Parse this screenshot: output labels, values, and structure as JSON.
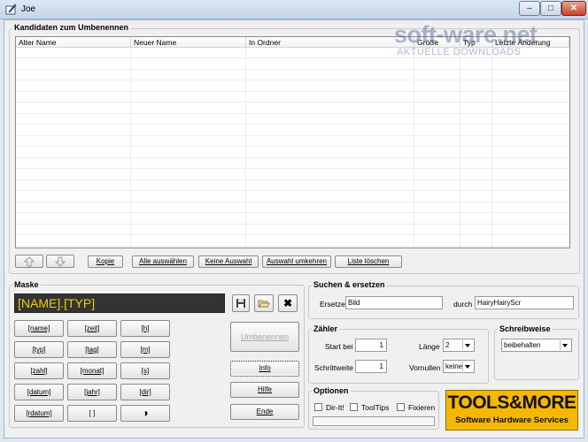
{
  "window": {
    "title": "Joe"
  },
  "candidates": {
    "title": "Kandidaten zum Umbenennen",
    "columns": [
      "Alter Name",
      "Neuer Name",
      "In Ordner",
      "Größe",
      "Typ",
      "Letzte Änderung"
    ],
    "rows": []
  },
  "toolbar": {
    "up_icon": "arrow-up-icon",
    "down_icon": "arrow-down-icon",
    "copy": "Kopie",
    "select_all": "Alle auswählen",
    "select_none": "Keine Auswahl",
    "invert_selection": "Auswahl umkehren",
    "clear_list": "Liste löschen"
  },
  "mask": {
    "title": "Maske",
    "value": "[NAME].[TYP]",
    "tokens": [
      [
        "[name]",
        "[zeit]",
        "[h]"
      ],
      [
        "[typ]",
        "[tag]",
        "[m]"
      ],
      [
        "[zahl]",
        "[monat]",
        "[s]"
      ],
      [
        "[datum]",
        "[jahr]",
        "[dir]"
      ],
      [
        "[rdatum]",
        "[ ]",
        "◑"
      ]
    ]
  },
  "actions": {
    "rename": "Umbenennen",
    "info": "Info",
    "help": "Hilfe",
    "exit": "Ende"
  },
  "search_replace": {
    "title": "Suchen & ersetzen",
    "replace_label": "Ersetze",
    "replace_value": "Bild",
    "by_label": "durch",
    "by_value": "HairyHairyScr"
  },
  "counter": {
    "title": "Zähler",
    "start_label": "Start bei",
    "start_value": "1",
    "length_label": "Länge",
    "length_value": "2",
    "step_label": "Schrittweite",
    "step_value": "1",
    "padding_label": "Vornullen",
    "padding_value": "keine"
  },
  "case": {
    "title": "Schreibweise",
    "value": "beibehalten"
  },
  "options": {
    "title": "Optionen",
    "items": [
      "Dir-It!",
      "ToolTips",
      "Fixieren"
    ]
  },
  "watermark": {
    "brand": "soft-ware.net",
    "tagline": "AKTUELLE DOWNLOADS"
  },
  "logo": {
    "main": "TOOLS&MORE",
    "sub": "Software Hardware Services"
  }
}
